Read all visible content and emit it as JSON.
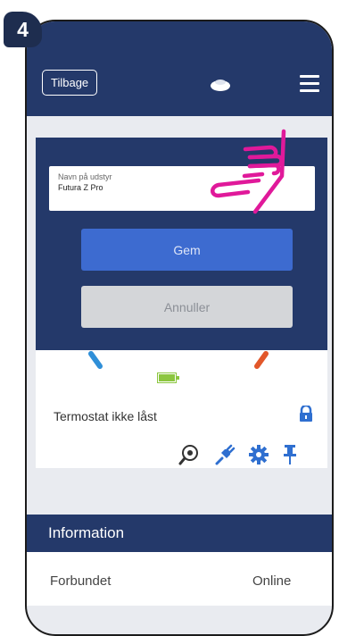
{
  "step_badge": "4",
  "header": {
    "back_label": "Tilbage"
  },
  "dialog": {
    "field_label": "Navn på udstyr",
    "field_value": "Futura Z Pro",
    "save_label": "Gem",
    "cancel_label": "Annuller"
  },
  "device": {
    "lock_status": "Termostat ikke låst"
  },
  "info": {
    "title": "Information",
    "row_label": "Forbundet",
    "row_value": "Online"
  },
  "colors": {
    "navy": "#24396a",
    "accent_blue": "#3d6bd0",
    "hand": "#e0199a"
  },
  "icons": [
    "menu-icon",
    "lock-icon",
    "eye-icon",
    "plug-icon",
    "gear-icon",
    "pin-icon",
    "hand-pointer-icon"
  ]
}
